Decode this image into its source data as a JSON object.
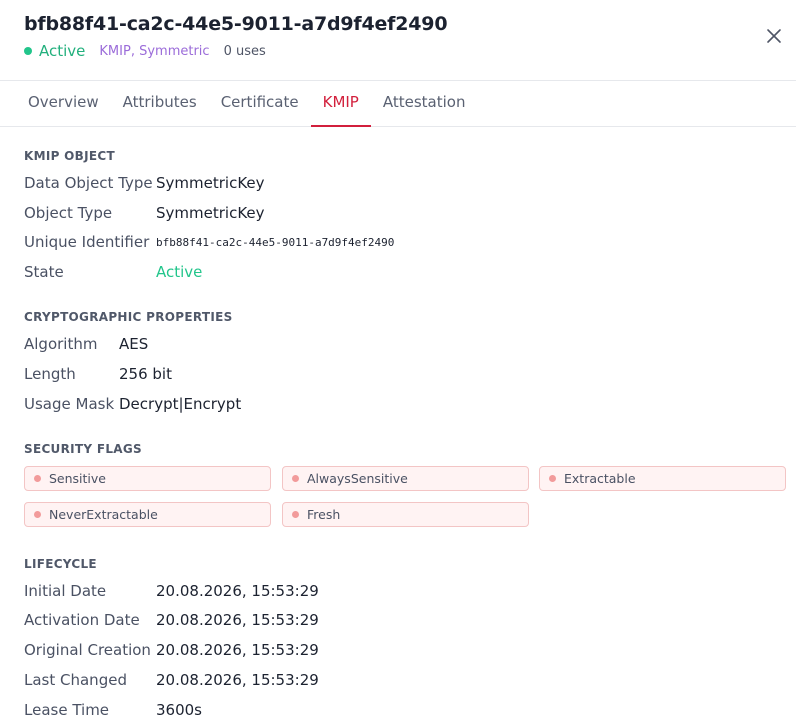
{
  "header": {
    "title": "bfb88f41-ca2c-44e5-9011-a7d9f4ef2490",
    "status": "Active",
    "tags": "KMIP, Symmetric",
    "uses": "0 uses"
  },
  "tabs": [
    {
      "label": "Overview"
    },
    {
      "label": "Attributes"
    },
    {
      "label": "Certificate"
    },
    {
      "label": "KMIP",
      "active": true
    },
    {
      "label": "Attestation"
    }
  ],
  "kmip_object": {
    "title": "KMIP OBJECT",
    "rows": [
      {
        "label": "Data Object Type",
        "value": "SymmetricKey"
      },
      {
        "label": "Object Type",
        "value": "SymmetricKey"
      },
      {
        "label": "Unique Identifier",
        "value": "bfb88f41-ca2c-44e5-9011-a7d9f4ef2490"
      },
      {
        "label": "State",
        "value": "Active"
      }
    ]
  },
  "crypto": {
    "title": "CRYPTOGRAPHIC PROPERTIES",
    "rows": [
      {
        "label": "Algorithm",
        "value": "AES"
      },
      {
        "label": "Length",
        "value": "256 bit"
      },
      {
        "label": "Usage Mask",
        "value": "Decrypt|Encrypt"
      }
    ]
  },
  "security_flags": {
    "title": "SECURITY FLAGS",
    "flags": [
      "Sensitive",
      "AlwaysSensitive",
      "Extractable",
      "NeverExtractable",
      "Fresh"
    ]
  },
  "lifecycle": {
    "title": "LIFECYCLE",
    "rows": [
      {
        "label": "Initial Date",
        "value": "20.08.2026, 15:53:29"
      },
      {
        "label": "Activation Date",
        "value": "20.08.2026, 15:53:29"
      },
      {
        "label": "Original Creation",
        "value": "20.08.2026, 15:53:29"
      },
      {
        "label": "Last Changed",
        "value": "20.08.2026, 15:53:29"
      },
      {
        "label": "Lease Time",
        "value": "3600s"
      }
    ]
  },
  "colors": {
    "accent": "#d21f3c",
    "active_green": "#22c58b",
    "tag_purple": "#9b6cd9",
    "flag_bg": "#fff3f3",
    "flag_border": "#f3c5c5"
  },
  "icons": {
    "status": "status-dot-icon",
    "close": "close-icon",
    "flag": "flag-dot-icon"
  }
}
